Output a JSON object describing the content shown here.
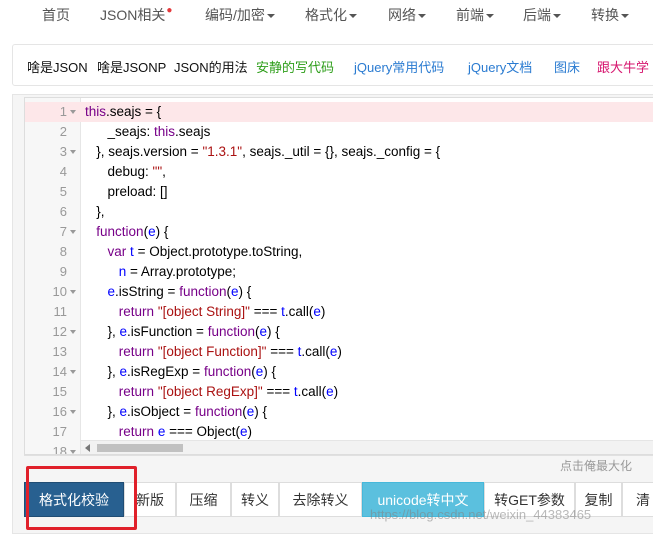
{
  "nav": {
    "items": [
      {
        "label": "首页",
        "caret": false,
        "flame": false
      },
      {
        "label": "JSON相关",
        "caret": false,
        "flame": true
      },
      {
        "label": "编码/加密",
        "caret": true,
        "flame": false
      },
      {
        "label": "格式化",
        "caret": true,
        "flame": false
      },
      {
        "label": "网络",
        "caret": true,
        "flame": false
      },
      {
        "label": "前端",
        "caret": true,
        "flame": false
      },
      {
        "label": "后端",
        "caret": true,
        "flame": false
      },
      {
        "label": "转换",
        "caret": true,
        "flame": false
      }
    ]
  },
  "links": [
    {
      "label": "啥是JSON",
      "color": "#111111"
    },
    {
      "label": "啥是JSONP",
      "color": "#111111"
    },
    {
      "label": "JSON的用法",
      "color": "#111111"
    },
    {
      "label": "安静的写代码",
      "color": "#2e9e1a"
    },
    {
      "label": "jQuery常用代码",
      "color": "#2a7bd1"
    },
    {
      "label": "jQuery文档",
      "color": "#2a7bd1"
    },
    {
      "label": "图床",
      "color": "#2a7bd1"
    },
    {
      "label": "跟大牛学",
      "color": "#d6156e"
    }
  ],
  "editor": {
    "lines": [
      {
        "n": "1",
        "fold": true,
        "hl": true,
        "tokens": [
          {
            "t": "this",
            "c": "kw"
          },
          {
            "t": ".seajs = {",
            "c": ""
          }
        ]
      },
      {
        "n": "2",
        "fold": false,
        "tokens": [
          {
            "t": "      _seajs: ",
            "c": ""
          },
          {
            "t": "this",
            "c": "kw"
          },
          {
            "t": ".seajs",
            "c": ""
          }
        ]
      },
      {
        "n": "3",
        "fold": true,
        "tokens": [
          {
            "t": "   }, seajs.version = ",
            "c": ""
          },
          {
            "t": "\"1.3.1\"",
            "c": "str"
          },
          {
            "t": ", seajs._util = {}, seajs._config = {",
            "c": ""
          }
        ]
      },
      {
        "n": "4",
        "fold": false,
        "tokens": [
          {
            "t": "      debug: ",
            "c": ""
          },
          {
            "t": "\"\"",
            "c": "str"
          },
          {
            "t": ",",
            "c": ""
          }
        ]
      },
      {
        "n": "5",
        "fold": false,
        "tokens": [
          {
            "t": "      preload: []",
            "c": ""
          }
        ]
      },
      {
        "n": "6",
        "fold": false,
        "tokens": [
          {
            "t": "   },",
            "c": ""
          }
        ]
      },
      {
        "n": "7",
        "fold": true,
        "tokens": [
          {
            "t": "   ",
            "c": ""
          },
          {
            "t": "function",
            "c": "kw"
          },
          {
            "t": "(",
            "c": ""
          },
          {
            "t": "e",
            "c": "prm"
          },
          {
            "t": ") {",
            "c": ""
          }
        ]
      },
      {
        "n": "8",
        "fold": false,
        "tokens": [
          {
            "t": "      ",
            "c": ""
          },
          {
            "t": "var",
            "c": "kw"
          },
          {
            "t": " ",
            "c": ""
          },
          {
            "t": "t",
            "c": "prm"
          },
          {
            "t": " = Object.prototype.toString,",
            "c": ""
          }
        ]
      },
      {
        "n": "9",
        "fold": false,
        "tokens": [
          {
            "t": "         ",
            "c": ""
          },
          {
            "t": "n",
            "c": "prm"
          },
          {
            "t": " = Array.prototype;",
            "c": ""
          }
        ]
      },
      {
        "n": "10",
        "fold": true,
        "tokens": [
          {
            "t": "      ",
            "c": ""
          },
          {
            "t": "e",
            "c": "prm"
          },
          {
            "t": ".isString = ",
            "c": ""
          },
          {
            "t": "function",
            "c": "kw"
          },
          {
            "t": "(",
            "c": ""
          },
          {
            "t": "e",
            "c": "prm"
          },
          {
            "t": ") {",
            "c": ""
          }
        ]
      },
      {
        "n": "11",
        "fold": false,
        "tokens": [
          {
            "t": "         ",
            "c": ""
          },
          {
            "t": "return",
            "c": "kw"
          },
          {
            "t": " ",
            "c": ""
          },
          {
            "t": "\"[object String]\"",
            "c": "str"
          },
          {
            "t": " === ",
            "c": ""
          },
          {
            "t": "t",
            "c": "prm"
          },
          {
            "t": ".call(",
            "c": ""
          },
          {
            "t": "e",
            "c": "prm"
          },
          {
            "t": ")",
            "c": ""
          }
        ]
      },
      {
        "n": "12",
        "fold": true,
        "tokens": [
          {
            "t": "      }, ",
            "c": ""
          },
          {
            "t": "e",
            "c": "prm"
          },
          {
            "t": ".isFunction = ",
            "c": ""
          },
          {
            "t": "function",
            "c": "kw"
          },
          {
            "t": "(",
            "c": ""
          },
          {
            "t": "e",
            "c": "prm"
          },
          {
            "t": ") {",
            "c": ""
          }
        ]
      },
      {
        "n": "13",
        "fold": false,
        "tokens": [
          {
            "t": "         ",
            "c": ""
          },
          {
            "t": "return",
            "c": "kw"
          },
          {
            "t": " ",
            "c": ""
          },
          {
            "t": "\"[object Function]\"",
            "c": "str"
          },
          {
            "t": " === ",
            "c": ""
          },
          {
            "t": "t",
            "c": "prm"
          },
          {
            "t": ".call(",
            "c": ""
          },
          {
            "t": "e",
            "c": "prm"
          },
          {
            "t": ")",
            "c": ""
          }
        ]
      },
      {
        "n": "14",
        "fold": true,
        "tokens": [
          {
            "t": "      }, ",
            "c": ""
          },
          {
            "t": "e",
            "c": "prm"
          },
          {
            "t": ".isRegExp = ",
            "c": ""
          },
          {
            "t": "function",
            "c": "kw"
          },
          {
            "t": "(",
            "c": ""
          },
          {
            "t": "e",
            "c": "prm"
          },
          {
            "t": ") {",
            "c": ""
          }
        ]
      },
      {
        "n": "15",
        "fold": false,
        "tokens": [
          {
            "t": "         ",
            "c": ""
          },
          {
            "t": "return",
            "c": "kw"
          },
          {
            "t": " ",
            "c": ""
          },
          {
            "t": "\"[object RegExp]\"",
            "c": "str"
          },
          {
            "t": " === ",
            "c": ""
          },
          {
            "t": "t",
            "c": "prm"
          },
          {
            "t": ".call(",
            "c": ""
          },
          {
            "t": "e",
            "c": "prm"
          },
          {
            "t": ")",
            "c": ""
          }
        ]
      },
      {
        "n": "16",
        "fold": true,
        "tokens": [
          {
            "t": "      }, ",
            "c": ""
          },
          {
            "t": "e",
            "c": "prm"
          },
          {
            "t": ".isObject = ",
            "c": ""
          },
          {
            "t": "function",
            "c": "kw"
          },
          {
            "t": "(",
            "c": ""
          },
          {
            "t": "e",
            "c": "prm"
          },
          {
            "t": ") {",
            "c": ""
          }
        ]
      },
      {
        "n": "17",
        "fold": false,
        "tokens": [
          {
            "t": "         ",
            "c": ""
          },
          {
            "t": "return",
            "c": "kw"
          },
          {
            "t": " ",
            "c": ""
          },
          {
            "t": "e",
            "c": "prm"
          },
          {
            "t": " === Object(",
            "c": ""
          },
          {
            "t": "e",
            "c": "prm"
          },
          {
            "t": ")",
            "c": ""
          }
        ]
      },
      {
        "n": "18",
        "fold": true,
        "tokens": []
      }
    ],
    "enlarge_hint": "点击俺最大化"
  },
  "buttons": [
    {
      "label": "格式化校验",
      "style": "primary"
    },
    {
      "label": "新版",
      "style": ""
    },
    {
      "label": "压缩",
      "style": ""
    },
    {
      "label": "转义",
      "style": ""
    },
    {
      "label": "去除转义",
      "style": ""
    },
    {
      "label": "unicode转中文",
      "style": "info"
    },
    {
      "label": "转GET参数",
      "style": ""
    },
    {
      "label": "复制",
      "style": ""
    },
    {
      "label": "清",
      "style": ""
    }
  ],
  "watermark": "https://blog.csdn.net/weixin_44383465",
  "colors": {
    "primary": "#286090",
    "info": "#5bc0de",
    "highlight": "#e0202a"
  }
}
